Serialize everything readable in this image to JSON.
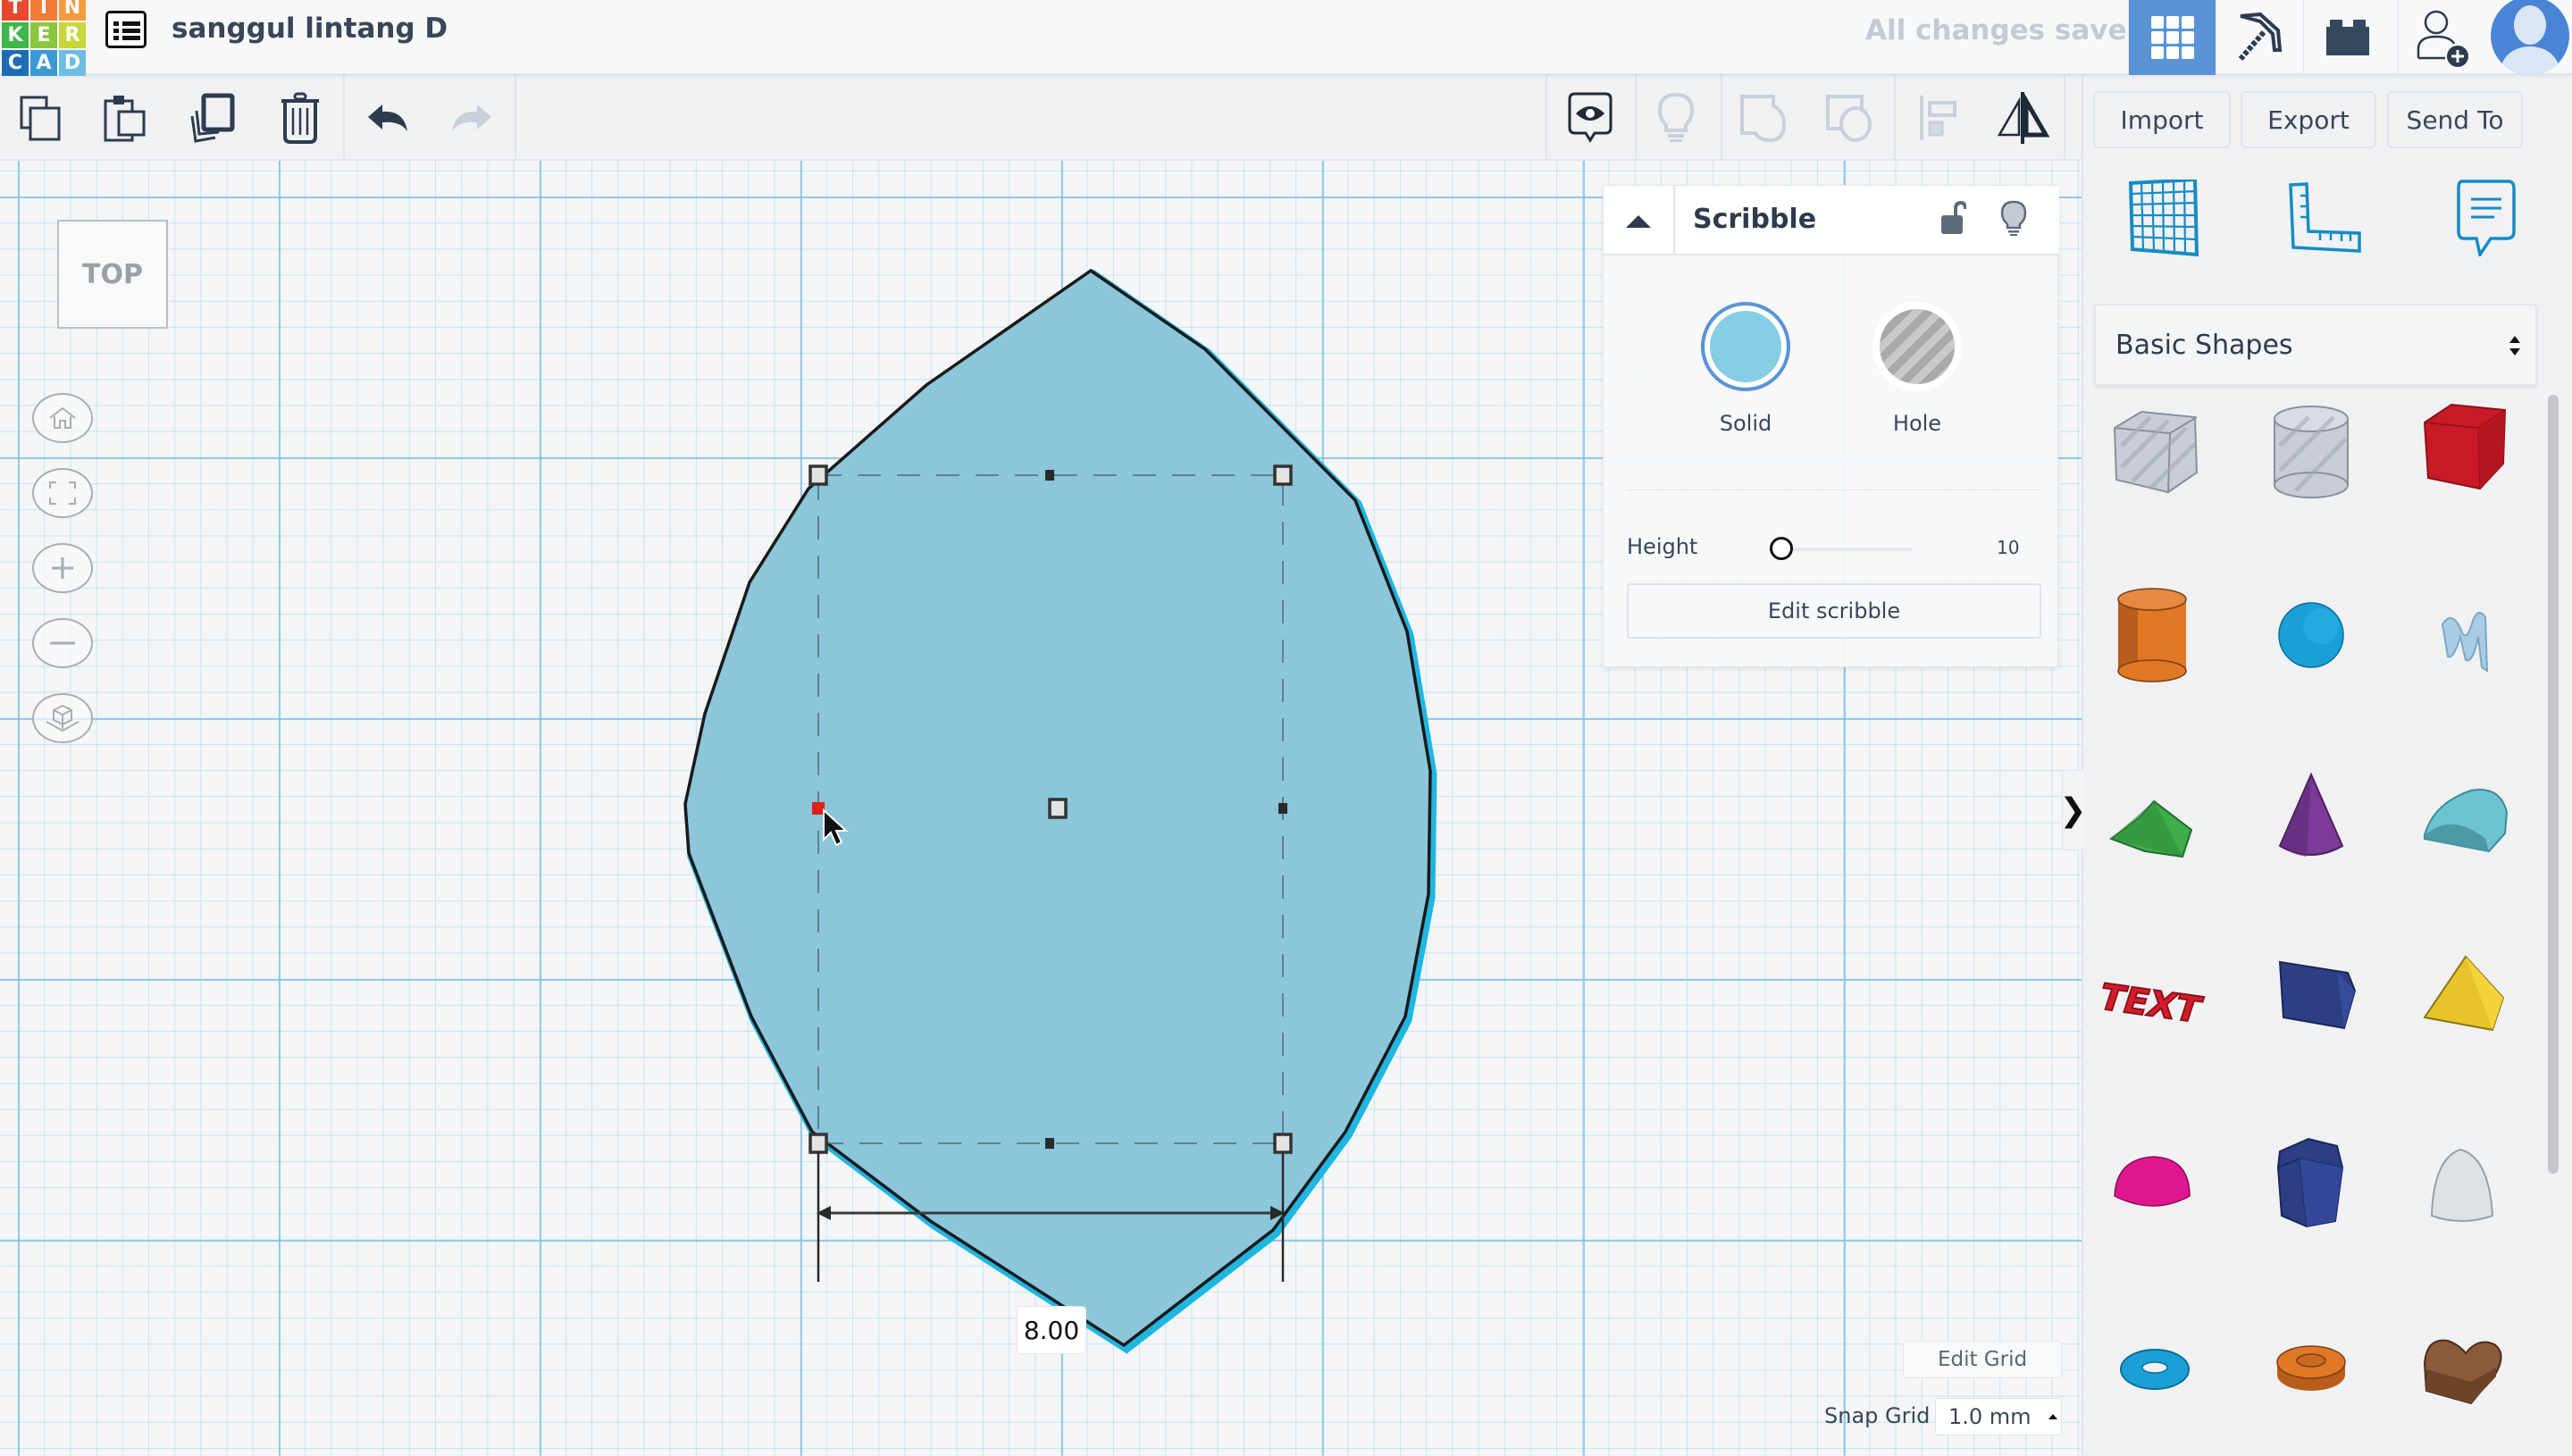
{
  "app": {
    "logo_letters": [
      "T",
      "I",
      "N",
      "K",
      "E",
      "R",
      "C",
      "A",
      "D"
    ],
    "logo_colors": [
      "#e8482e",
      "#f27b36",
      "#f59b3f",
      "#3fb649",
      "#8cc63f",
      "#c8d63b",
      "#1b6db3",
      "#3a9ad6",
      "#6bbde3"
    ],
    "title": "sanggul lintang D",
    "save_status": "All changes saved"
  },
  "topbar": {
    "views": [
      {
        "name": "3d-design-view",
        "icon": "grid-icon",
        "active": true
      },
      {
        "name": "minecraft-view",
        "icon": "pickaxe-icon",
        "active": false
      },
      {
        "name": "brick-view",
        "icon": "brick-icon",
        "active": false
      },
      {
        "name": "invite-user",
        "icon": "add-user-icon",
        "active": false
      }
    ],
    "accent": "#5b94d6"
  },
  "toolbar": {
    "left_tools": [
      {
        "name": "copy",
        "icon": "copy-icon",
        "enabled": true
      },
      {
        "name": "paste",
        "icon": "paste-icon",
        "enabled": true
      },
      {
        "name": "duplicate",
        "icon": "duplicate-icon",
        "enabled": true
      },
      {
        "name": "delete",
        "icon": "trash-icon",
        "enabled": true
      },
      {
        "name": "undo",
        "icon": "undo-icon",
        "enabled": true
      },
      {
        "name": "redo",
        "icon": "redo-icon",
        "enabled": false
      }
    ],
    "right_tools": [
      {
        "name": "notes",
        "icon": "eye-comment-icon",
        "enabled": true
      },
      {
        "name": "show-all",
        "icon": "lightbulb-icon",
        "enabled": false
      },
      {
        "name": "group",
        "icon": "group-icon",
        "enabled": false
      },
      {
        "name": "ungroup",
        "icon": "ungroup-icon",
        "enabled": false
      },
      {
        "name": "align",
        "icon": "align-icon",
        "enabled": false
      },
      {
        "name": "mirror",
        "icon": "mirror-icon",
        "enabled": true
      }
    ],
    "import_label": "Import",
    "export_label": "Export",
    "send_to_label": "Send To"
  },
  "canvas": {
    "view_cube_label": "TOP",
    "nav_buttons": [
      "home-icon",
      "fit-view-icon",
      "zoom-in-icon",
      "zoom-out-icon",
      "perspective-icon"
    ],
    "dimension_label": "8.00",
    "shape_fill": "#8bc6da",
    "shape_outline": "#1a1a1a",
    "shape_glow": "#1fb6e0",
    "selected_handle_color": "#e0201b"
  },
  "inspector": {
    "title": "Scribble",
    "solid_label": "Solid",
    "hole_label": "Hole",
    "solid_color": "#86cee4",
    "height_label": "Height",
    "height_value": "10",
    "height_slider_fraction": 0.0,
    "edit_label": "Edit scribble",
    "mode_selected": "Solid"
  },
  "grid": {
    "edit_grid_label": "Edit Grid",
    "snap_label": "Snap Grid",
    "snap_value": "1.0 mm"
  },
  "library": {
    "top_icons": [
      "workplane-icon",
      "ruler-icon",
      "note-icon"
    ],
    "category": "Basic Shapes",
    "shapes": [
      {
        "name": "box-hole",
        "color": "#c9ced6"
      },
      {
        "name": "cylinder-hole",
        "color": "#c9ced6"
      },
      {
        "name": "box",
        "color": "#c91a27"
      },
      {
        "name": "cylinder",
        "color": "#e07826"
      },
      {
        "name": "sphere",
        "color": "#1aa0d6"
      },
      {
        "name": "scribble",
        "color": "#a8cce4"
      },
      {
        "name": "roof",
        "color": "#3fae4a"
      },
      {
        "name": "cone",
        "color": "#7b3b96"
      },
      {
        "name": "round-roof",
        "color": "#6cc4d2"
      },
      {
        "name": "text",
        "color": "#d41c2a"
      },
      {
        "name": "wedge",
        "color": "#2c3f85"
      },
      {
        "name": "pyramid",
        "color": "#e6c42a"
      },
      {
        "name": "half-sphere",
        "color": "#e0168f"
      },
      {
        "name": "polygon",
        "color": "#2c3f85"
      },
      {
        "name": "paraboloid",
        "color": "#dfe2e5"
      },
      {
        "name": "torus",
        "color": "#1aa0d6"
      },
      {
        "name": "tube",
        "color": "#e07826"
      },
      {
        "name": "heart",
        "color": "#8a5a3a"
      }
    ]
  }
}
